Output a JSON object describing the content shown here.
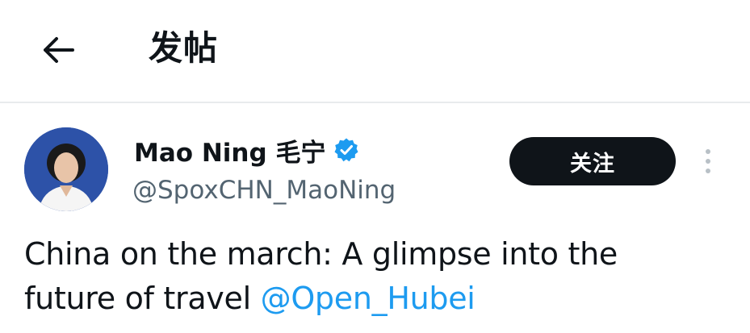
{
  "header": {
    "title": "发帖",
    "back_icon": "arrow-left-icon"
  },
  "tweet": {
    "author": {
      "display_name": "Mao Ning 毛宁",
      "handle": "@SpoxCHN_MaoNing",
      "verified_icon": "verified-badge-icon",
      "avatar_icon": "avatar"
    },
    "follow_label": "关注",
    "more_icon": "more-vertical-icon",
    "text_line1": "China on the march: A glimpse into the",
    "text_line2": "future of travel",
    "mention": "@Open_Hubei"
  },
  "colors": {
    "text": "#0f1419",
    "secondary": "#536471",
    "link": "#1d9bf0",
    "verified": "#1d9bf0",
    "follow_bg": "#0f1419",
    "divider": "#e8ebed"
  }
}
